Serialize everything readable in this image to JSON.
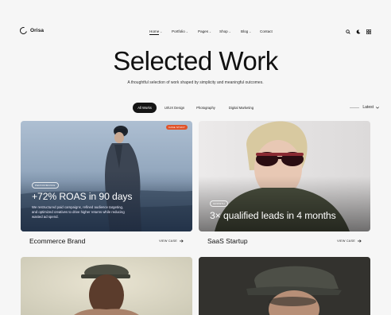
{
  "brand": {
    "name": "Orisa"
  },
  "nav": [
    {
      "label": "Home",
      "has_caret": true,
      "active": true
    },
    {
      "label": "Portfolio",
      "has_caret": true,
      "active": false
    },
    {
      "label": "Pages",
      "has_caret": true,
      "active": false
    },
    {
      "label": "Shop",
      "has_caret": true,
      "active": false
    },
    {
      "label": "Blog",
      "has_caret": true,
      "active": false
    },
    {
      "label": "Contact",
      "has_caret": false,
      "active": false
    }
  ],
  "header_icons": [
    "search-icon",
    "moon-icon",
    "grid-menu-icon"
  ],
  "hero": {
    "title": "Selected Work",
    "subtitle": "A thoughtful selection of work shaped by simplicity and meaningful outcomes."
  },
  "filters": [
    {
      "label": "All Works",
      "active": true
    },
    {
      "label": "UI/UX Design",
      "active": false
    },
    {
      "label": "Photography",
      "active": false
    },
    {
      "label": "Digital Marketing",
      "active": false
    }
  ],
  "sort": {
    "label": "Latest",
    "icon": "chevron-down-icon"
  },
  "projects": [
    {
      "name": "Ecommerce Brand",
      "badge": "CASE STUDY",
      "tag": "PERFORMANCE",
      "headline": "+72% ROAS in 90 days",
      "description": "We restructured paid campaigns, refined audience targeting, and optimized creatives to drive higher returns while reducing wasted ad spend.",
      "link": "VIEW CASE",
      "accent": "#e0532a"
    },
    {
      "name": "SaaS Startup",
      "tag": "GROWTH",
      "headline": "3× qualified leads in 4 months",
      "link": "VIEW CASE"
    },
    {
      "name": "",
      "headline": ""
    },
    {
      "name": "",
      "headline": ""
    }
  ],
  "colors": {
    "background": "#f6f6f6",
    "text": "#111111",
    "chip_active": "#141414",
    "badge": "#e0532a"
  }
}
